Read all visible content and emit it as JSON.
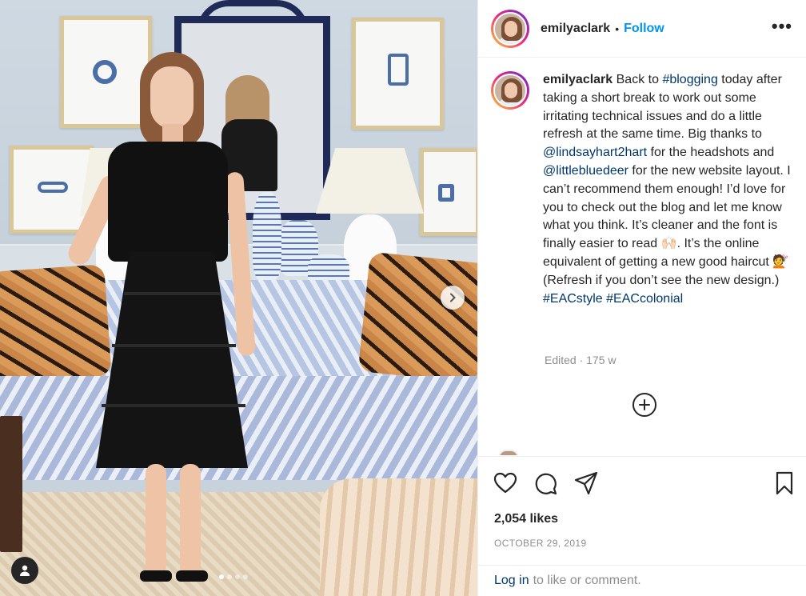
{
  "post": {
    "username": "emilyaclark",
    "separator": "•",
    "follow_label": "Follow",
    "more_label": "•••",
    "caption": {
      "user": "emilyaclark",
      "t1": " Back to ",
      "tag1": "#blogging",
      "t2": " today after taking a short break to work out some irritating technical issues and do a little refresh at the same time. Big thanks to ",
      "mention1": "@lindsayhart2hart",
      "t3": " for the headshots and ",
      "mention2": "@littlebluedeer",
      "t4": " for the new website layout. I can’t recommend them enough! I’d love for you to check out the blog and let me know what you think. It’s cleaner and the font is finally easier to read ",
      "emoji1": "🙌🏻",
      "t5": ". It’s the online equivalent of getting a new good haircut ",
      "emoji2": "💇",
      "t6": " (Refresh if you don’t see the new design.) ",
      "tag2": "#EACstyle",
      "t7": " ",
      "tag3": "#EACcolonial"
    },
    "meta": "Edited · 175 w",
    "likes": "2,054 likes",
    "date": "OCTOBER 29, 2019",
    "footer": {
      "login_label": "Log in",
      "rest": "to like or comment."
    }
  },
  "carousel": {
    "current": 1,
    "total": 4
  },
  "icons": {
    "heart": "heart-icon",
    "comment": "comment-icon",
    "share": "share-icon",
    "save": "bookmark-icon",
    "load_more": "plus-circle-icon",
    "user_tag": "user-tag-icon",
    "next": "chevron-right-icon"
  }
}
